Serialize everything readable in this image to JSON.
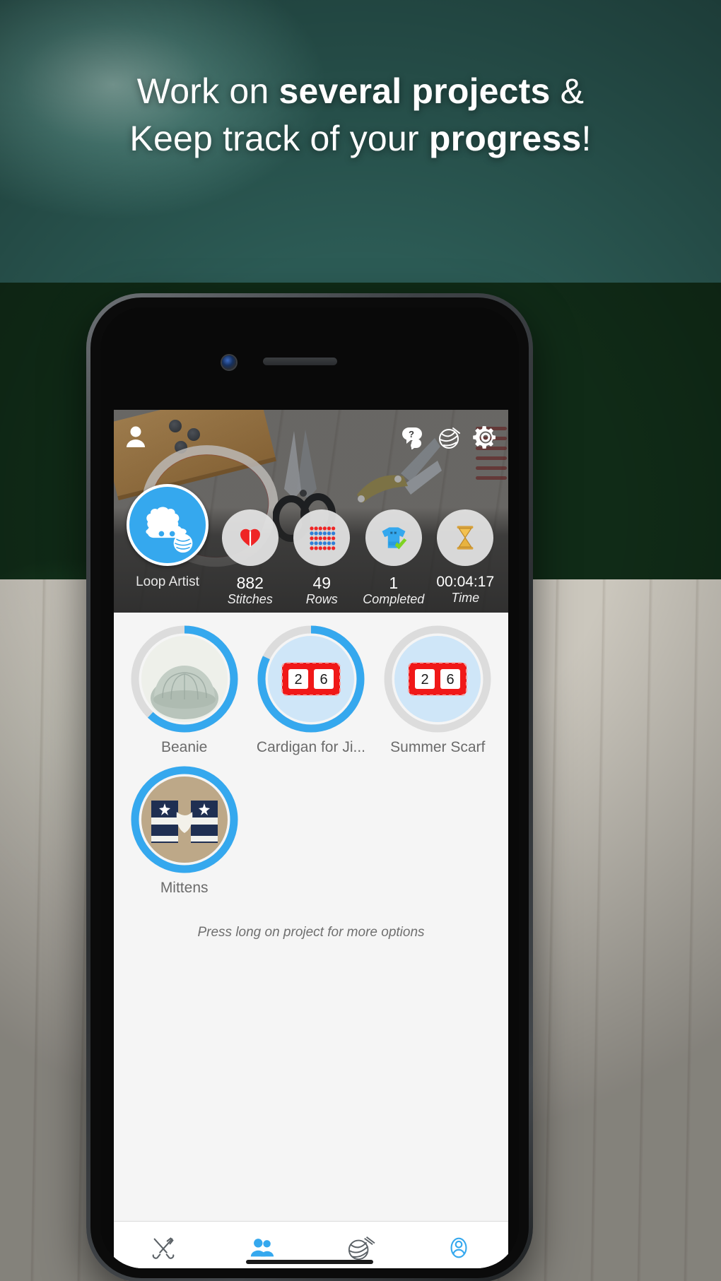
{
  "promo": {
    "line1_prefix": "Work on ",
    "line1_bold": "several projects",
    "line1_suffix": " &",
    "line2_prefix": "Keep track of your ",
    "line2_bold": "progress",
    "line2_suffix": "!"
  },
  "accent_color": "#35a8ee",
  "app": {
    "header": {
      "icons": [
        {
          "name": "profile-icon",
          "label": "Profile"
        },
        {
          "name": "help-icon",
          "label": "Help"
        },
        {
          "name": "yarn-ball-icon",
          "label": "Yarn"
        },
        {
          "name": "gear-icon",
          "label": "Settings"
        }
      ],
      "user_name": "Loop Artist",
      "stats": [
        {
          "icon": "stitches-icon",
          "value": "882",
          "caption": "Stitches"
        },
        {
          "icon": "rows-icon",
          "value": "49",
          "caption": "Rows"
        },
        {
          "icon": "completed-icon",
          "value": "1",
          "caption": "Completed"
        },
        {
          "icon": "hourglass-icon",
          "value": "00:04:17",
          "caption": "Time"
        }
      ]
    },
    "projects": [
      {
        "name": "Beanie",
        "thumb": "beanie",
        "progress": 62,
        "counter": null
      },
      {
        "name": "Cardigan for Ji...",
        "thumb": "counter",
        "progress": 82,
        "counter": [
          "2",
          "6"
        ]
      },
      {
        "name": "Summer Scarf",
        "thumb": "counter",
        "progress": 0,
        "counter": [
          "2",
          "6"
        ]
      },
      {
        "name": "Mittens",
        "thumb": "mittens",
        "progress": 100,
        "counter": null
      }
    ],
    "hint": "Press long on project for more options",
    "tabs": [
      {
        "name": "tab-tools",
        "icon": "tools-icon",
        "active": false
      },
      {
        "name": "tab-projects",
        "icon": "people-icon",
        "active": true
      },
      {
        "name": "tab-yarn",
        "icon": "yarn-ball-icon",
        "active": false
      },
      {
        "name": "tab-account",
        "icon": "person-outline-icon",
        "active": false
      }
    ]
  }
}
